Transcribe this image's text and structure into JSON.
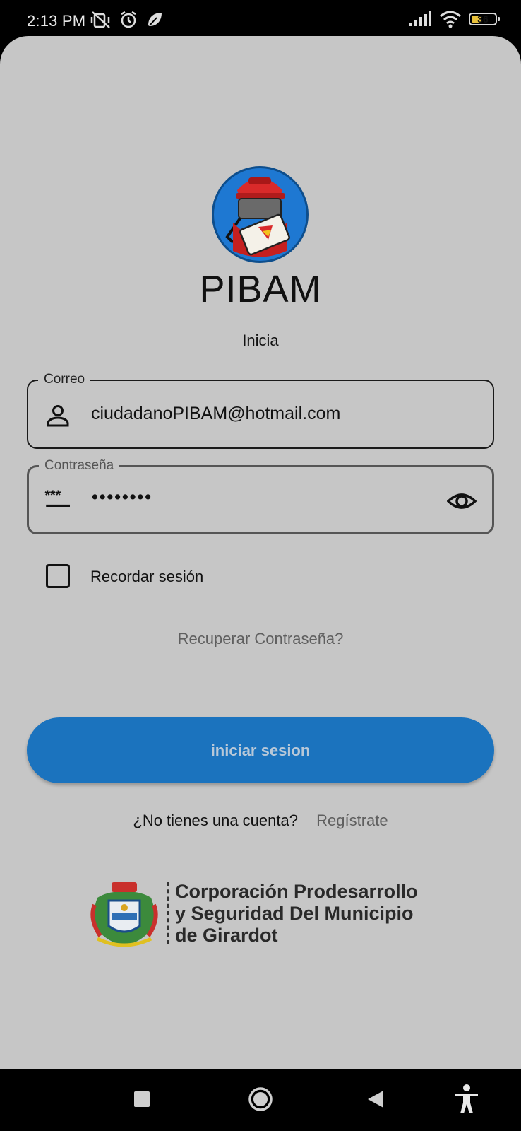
{
  "status_bar": {
    "time": "2:13 PM",
    "battery_level": "36"
  },
  "app": {
    "name": "PIBAM",
    "subtitle": "Inicia"
  },
  "form": {
    "email": {
      "label": "Correo",
      "value": "ciudadanoPIBAM@hotmail.com",
      "icon": "person-icon"
    },
    "password": {
      "label": "Contraseña",
      "value": "••••••••",
      "icon": "password-icon",
      "toggle_icon": "eye-icon"
    },
    "remember": {
      "label": "Recordar sesión",
      "checked": false
    },
    "recover_link": "Recuperar Contraseña?",
    "submit_label": "iniciar sesion",
    "signup_prompt": "¿No tienes una cuenta?",
    "signup_link": "Regístrate"
  },
  "footer": {
    "organization_lines": [
      "Corporación Prodesarrollo",
      "y Seguridad Del Municipio",
      "de Girardot"
    ]
  },
  "colors": {
    "background": "#c6c6c6",
    "primary_button": "#1b73be",
    "link": "#5f5f5f"
  }
}
